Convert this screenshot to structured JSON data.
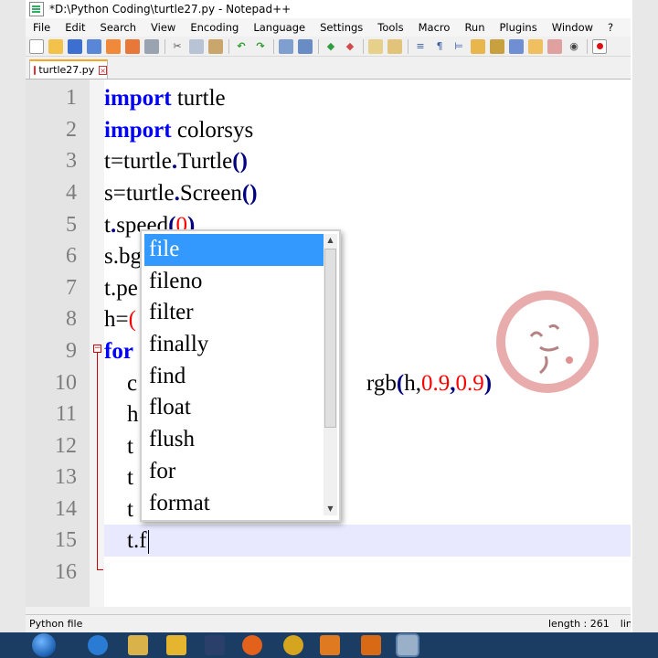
{
  "window": {
    "title": "*D:\\Python Coding\\turtle27.py - Notepad++"
  },
  "menu": [
    "File",
    "Edit",
    "Search",
    "View",
    "Encoding",
    "Language",
    "Settings",
    "Tools",
    "Macro",
    "Run",
    "Plugins",
    "Window",
    "?"
  ],
  "toolbar_icons": [
    "new-file",
    "open-file",
    "save",
    "save-all",
    "close",
    "close-all",
    "print",
    "cut",
    "copy",
    "paste",
    "undo",
    "redo",
    "find",
    "replace",
    "zoom-in",
    "zoom-out",
    "sync-vertical",
    "sync-horizontal",
    "word-wrap",
    "show-all-chars",
    "indent-guide",
    "user-language",
    "doc-map",
    "function-list",
    "folder-as-workspace",
    "monitoring",
    "record-macro"
  ],
  "tab": {
    "label": "turtle27.py",
    "close_symbol": "×"
  },
  "editor": {
    "line_numbers": [
      "1",
      "2",
      "3",
      "4",
      "5",
      "6",
      "7",
      "8",
      "9",
      "10",
      "11",
      "12",
      "13",
      "14",
      "15",
      "16"
    ],
    "lines": [
      {
        "kw": "import",
        "rest": " turtle"
      },
      {
        "kw": "import",
        "rest": " colorsys"
      },
      {
        "a": "t=turtle",
        "b": ".",
        "c": "Turtle",
        "d": "()"
      },
      {
        "a": "s=turtle",
        "b": ".",
        "c": "Screen",
        "d": "()"
      },
      {
        "a": "t",
        "b": ".",
        "c": "speed",
        "p1": "(",
        "n": "0",
        "p2": ")"
      },
      {
        "text": "s.bg"
      },
      {
        "text": "t.pe"
      },
      {
        "text": "h=",
        "p": "("
      },
      {
        "kw": "for"
      },
      {
        "indent": "    c",
        "tail": "rgb",
        "p1": "(",
        "mid": "h,",
        "n1": "0.9",
        "comma": ",",
        "n2": "0.9",
        "p2": ")"
      },
      {
        "text": "    h"
      },
      {
        "text": "    t"
      },
      {
        "text": "    t"
      },
      {
        "text": "    t"
      },
      {
        "text": "    t.f"
      },
      {
        "text": ""
      }
    ]
  },
  "autocomplete": {
    "items": [
      "file",
      "fileno",
      "filter",
      "finally",
      "find",
      "float",
      "flush",
      "for",
      "format"
    ],
    "selected_index": 0
  },
  "status": {
    "file_type": "Python file",
    "length": "length : 261",
    "lines": "lines"
  },
  "colors": {
    "keyword": "#0000ff",
    "number": "#ff0000",
    "selection": "#3399ff",
    "current_line": "#e8e8ff",
    "taskbar": "#1b3d63"
  }
}
